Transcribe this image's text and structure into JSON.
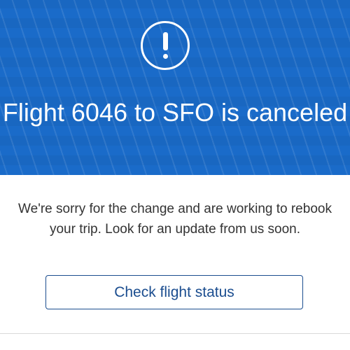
{
  "banner": {
    "icon": "exclamation-circle-icon",
    "headline": "Flight 6046 to SFO is canceled",
    "background_color": "#1a6bc9"
  },
  "message": "We're sorry for the change and are working to rebook your trip. Look for an update from us soon.",
  "actions": {
    "check_status_label": "Check flight status"
  },
  "colors": {
    "button_text": "#1b4d8f",
    "body_text": "#333333"
  }
}
